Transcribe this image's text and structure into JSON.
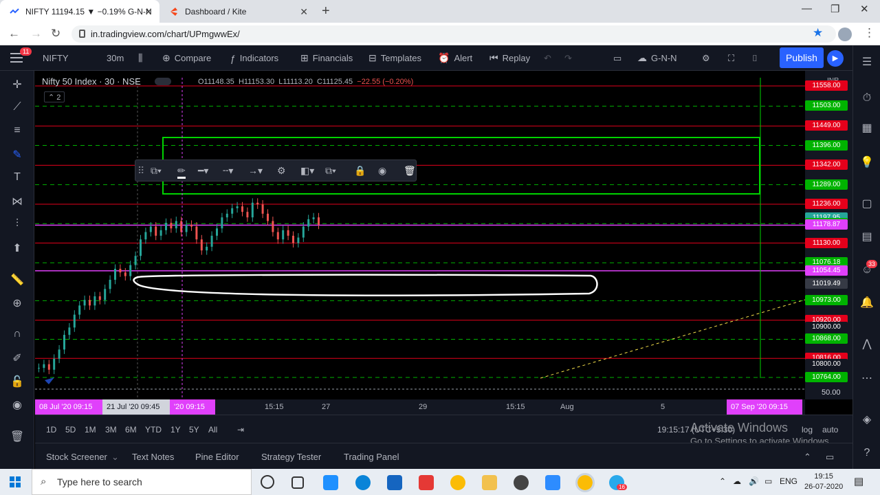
{
  "browser": {
    "tabs": [
      {
        "title": "NIFTY 11194.15 ▼ −0.19% G-N-N"
      },
      {
        "title": "Dashboard / Kite"
      }
    ],
    "url": "in.tradingview.com/chart/UPmgwwEx/",
    "notification_count": "11"
  },
  "toolbar": {
    "symbol": "NIFTY",
    "interval": "30m",
    "compare": "Compare",
    "indicators": "Indicators",
    "financials": "Financials",
    "templates": "Templates",
    "alert": "Alert",
    "replay": "Replay",
    "layout_name": "G-N-N",
    "publish": "Publish"
  },
  "legend": {
    "name": "Nifty 50 Index · 30 · NSE",
    "open": "O11148.35",
    "high": "H11153.30",
    "low": "L11113.20",
    "close": "C11125.45",
    "change": "−22.55 (−0.20%)",
    "indicator_count": "2"
  },
  "price_axis": {
    "currency": "INR",
    "labels": [
      {
        "text": "11558.00",
        "price": 11558,
        "color": "#e4001b"
      },
      {
        "text": "11503.00",
        "price": 11503,
        "color": "#00b300"
      },
      {
        "text": "11449.00",
        "price": 11449,
        "color": "#e4001b"
      },
      {
        "text": "11396.00",
        "price": 11396,
        "color": "#00b300"
      },
      {
        "text": "11342.00",
        "price": 11342,
        "color": "#e4001b"
      },
      {
        "text": "11289.00",
        "price": 11289,
        "color": "#00b300"
      },
      {
        "text": "11236.00",
        "price": 11236,
        "color": "#e4001b"
      },
      {
        "text": "11197.95",
        "price": 11197.95,
        "color": "#26a69a"
      },
      {
        "text": "11183.00",
        "price": 11183,
        "color": "#00b300"
      },
      {
        "text": "11178.87",
        "price": 11178.87,
        "color": "#e040fb"
      },
      {
        "text": "11130.00",
        "price": 11130,
        "color": "#e4001b"
      },
      {
        "text": "11076.18",
        "price": 11076.18,
        "color": "#00b300"
      },
      {
        "text": "11054.45",
        "price": 11054.45,
        "color": "#e040fb"
      },
      {
        "text": "11019.49",
        "price": 11019.49,
        "color": "#363a45"
      },
      {
        "text": "10973.00",
        "price": 10973,
        "color": "#00b300"
      },
      {
        "text": "10920.00",
        "price": 10920,
        "color": "#e4001b"
      },
      {
        "text": "10900.00",
        "price": 10900,
        "color": "#131722"
      },
      {
        "text": "10868.00",
        "price": 10868,
        "color": "#00b300"
      },
      {
        "text": "10816.00",
        "price": 10816,
        "color": "#e4001b"
      },
      {
        "text": "10800.00",
        "price": 10800,
        "color": "#131722"
      },
      {
        "text": "10764.00",
        "price": 10764,
        "color": "#00b300"
      }
    ],
    "volume_label": "50.00"
  },
  "time_axis": {
    "highlight_left": "08 Jul '20  09:15",
    "highlight_mid": "21 Jul '20  09:45",
    "highlight_mid2": "'20  09:15",
    "labels": [
      "15:15",
      "27",
      "29",
      "15:15",
      "Aug",
      "5"
    ],
    "highlight_right": "07 Sep '20  09:15"
  },
  "range": {
    "buttons": [
      "1D",
      "5D",
      "1M",
      "3M",
      "6M",
      "YTD",
      "1Y",
      "5Y",
      "All"
    ],
    "clock": "19:15:17 (UTC+5:30)",
    "log": "log",
    "auto": "auto"
  },
  "watermark": {
    "line1": "Activate Windows",
    "line2": "Go to Settings to activate Windows."
  },
  "bottom_tabs": [
    "Stock Screener",
    "Text Notes",
    "Pine Editor",
    "Strategy Tester",
    "Trading Panel"
  ],
  "chart_badge": "33",
  "taskbar": {
    "search_placeholder": "Type here to search",
    "lang": "ENG",
    "time": "19:15",
    "date": "26-07-2020",
    "badge": "16"
  },
  "colors": {
    "bg": "#000000",
    "resistance": "#e4001b",
    "support": "#00b300",
    "accent": "#2962ff",
    "up": "#26a69a",
    "down": "#ef5350"
  }
}
